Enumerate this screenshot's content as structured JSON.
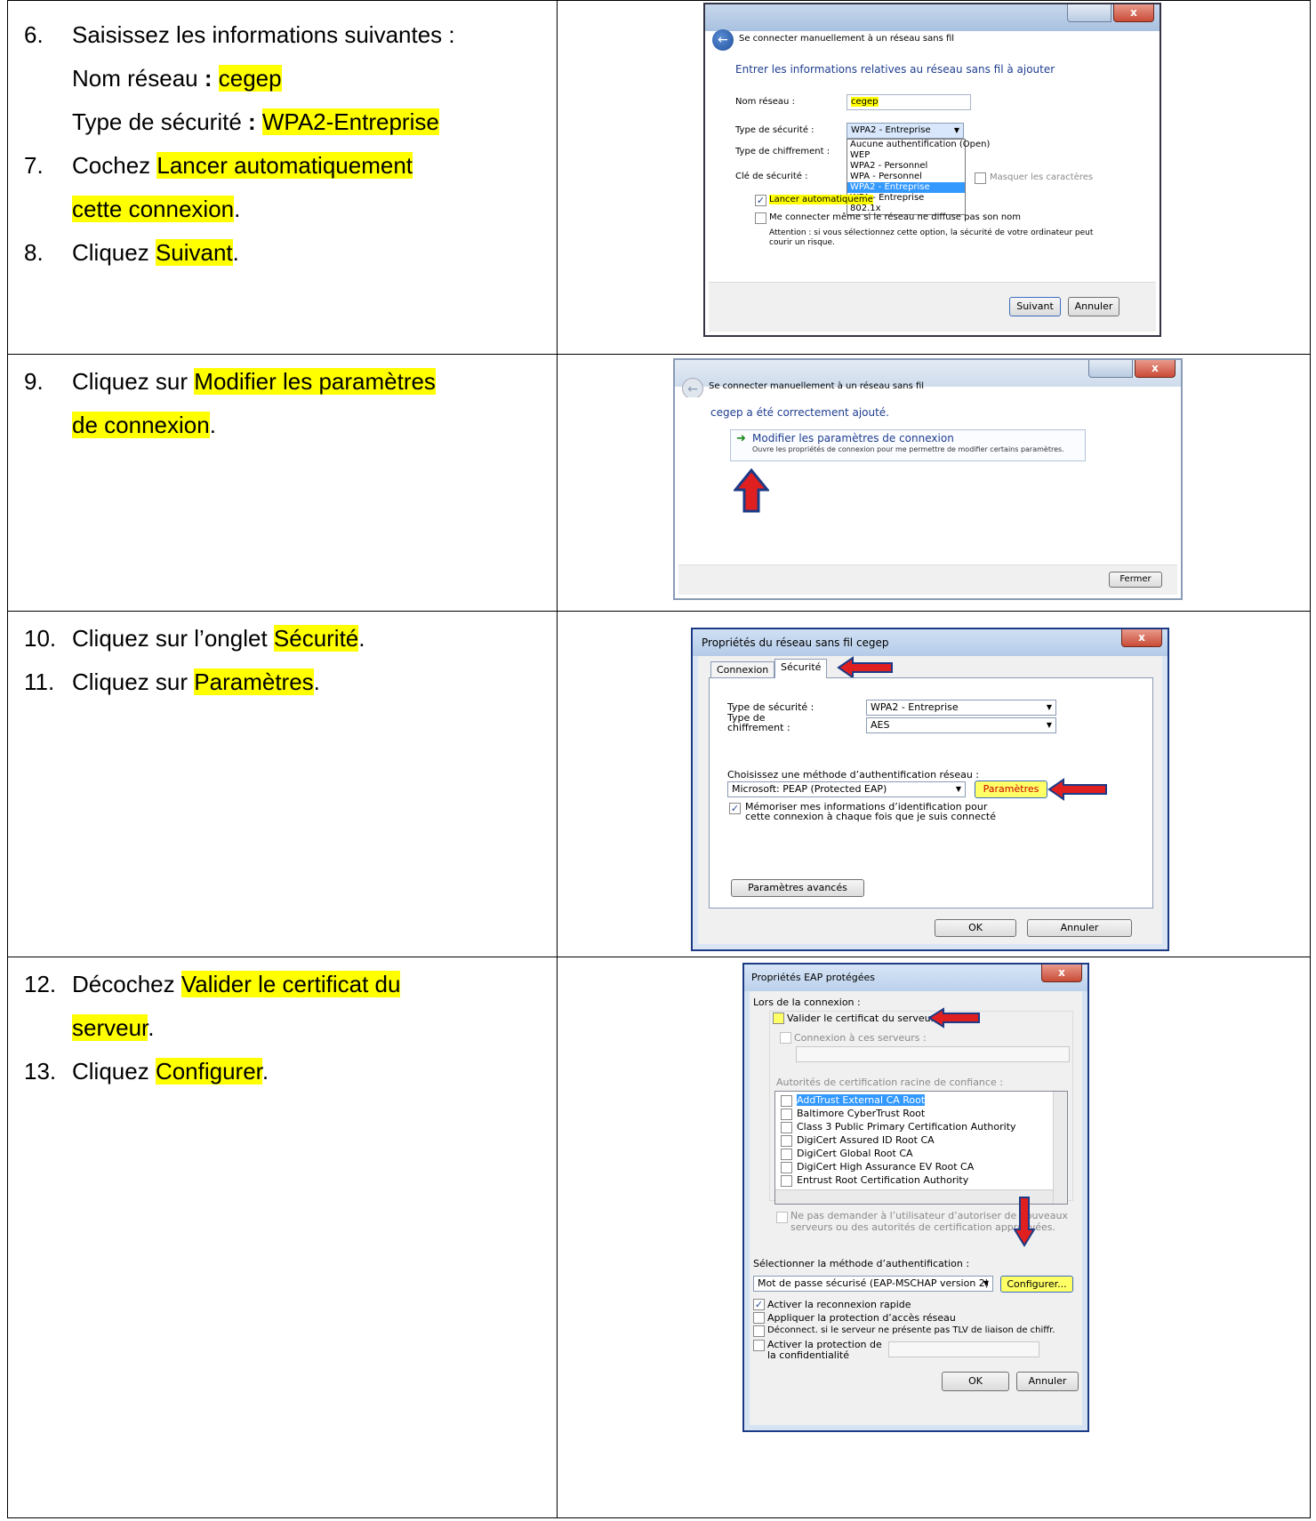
{
  "instructions": {
    "row1": {
      "step6_num": "6.",
      "step6_text": "Saisissez les informations suivantes :",
      "step6_name_label": "Nom réseau",
      "step6_name_sep": " : ",
      "step6_name_value": "cegep",
      "step6_type_label": "Type de sécurité",
      "step6_type_sep": " : ",
      "step6_type_value": "WPA2-Entreprise",
      "step7_num": "7.",
      "step7_prefix": "Cochez ",
      "step7_highlight_line1": "Lancer automatiquement",
      "step7_highlight_line2": "cette connexion",
      "step7_suffix": ".",
      "step8_num": "8.",
      "step8_prefix": "Cliquez ",
      "step8_highlight": "Suivant",
      "step8_suffix": "."
    },
    "row2": {
      "step9_num": "9.",
      "step9_prefix": "Cliquez sur ",
      "step9_highlight_line1": "Modifier les paramètres",
      "step9_highlight_line2": "de connexion",
      "step9_suffix": "."
    },
    "row3": {
      "step10_num": "10.",
      "step10_prefix": "Cliquez sur l’onglet ",
      "step10_highlight": "Sécurité",
      "step10_suffix": ".",
      "step11_num": "11.",
      "step11_prefix": "Cliquez sur ",
      "step11_highlight": "Paramètres",
      "step11_suffix": "."
    },
    "row4": {
      "step12_num": "12.",
      "step12_prefix": "Décochez ",
      "step12_highlight_line1": "Valider le certificat du",
      "step12_highlight_line2": "serveur",
      "step12_suffix": ".",
      "step13_num": "13.",
      "step13_prefix": "Cliquez ",
      "step13_highlight": "Configurer",
      "step13_suffix": "."
    }
  },
  "dialog1": {
    "window_title": "Se connecter manuellement à un réseau sans fil",
    "heading": "Entrer les informations relatives au réseau sans fil à ajouter",
    "label_name": "Nom réseau :",
    "value_name": "cegep",
    "label_security": "Type de sécurité :",
    "value_security": "WPA2 - Entreprise",
    "label_encryption": "Type de chiffrement :",
    "label_key": "Clé de sécurité :",
    "dropdown_options": [
      "Aucune authentification (Open)",
      "WEP",
      "WPA2 - Personnel",
      "WPA - Personnel",
      "WPA2 - Entreprise",
      "WPA - Entreprise",
      "802.1x"
    ],
    "hide_chars": "Masquer les caractères",
    "auto_start": "Lancer automatiqueme",
    "connect_hidden": "Me connecter même si le réseau ne diffuse pas son nom",
    "warning": "Attention : si vous sélectionnez cette option, la sécurité de votre ordinateur peut courir un risque.",
    "next_button": "Suivant",
    "cancel_button": "Annuler"
  },
  "dialog2": {
    "window_title": "Se connecter manuellement à un réseau sans fil",
    "heading": "cegep a été correctement ajouté.",
    "link_title": "Modifier les paramètres de connexion",
    "link_desc": "Ouvre les propriétés de connexion pour me permettre de modifier certains paramètres.",
    "close_button": "Fermer"
  },
  "dialog3": {
    "window_title": "Propriétés du réseau sans fil cegep",
    "tab_connection": "Connexion",
    "tab_security": "Sécurité",
    "label_security": "Type de sécurité :",
    "value_security": "WPA2 - Entreprise",
    "label_encryption_1": "Type de",
    "label_encryption_2": "chiffrement :",
    "value_encryption": "AES",
    "auth_label": "Choisissez une méthode d’authentification réseau :",
    "auth_value": "Microsoft: PEAP (Protected EAP)",
    "settings_button": "Paramètres",
    "remember_1": "Mémoriser mes informations d’identification pour",
    "remember_2": "cette connexion à chaque fois que je suis connecté",
    "advanced_button": "Paramètres avancés",
    "ok_button": "OK",
    "cancel_button": "Annuler"
  },
  "dialog4": {
    "window_title": "Propriétés EAP protégées",
    "on_connect": "Lors de la connexion :",
    "validate_cert": "Valider le certificat du serveur",
    "connect_servers": "Connexion à ces serveurs :",
    "root_ca_label": "Autorités de certification racine de confiance :",
    "ca_list": [
      "AddTrust External CA Root",
      "Baltimore CyberTrust Root",
      "Class 3 Public Primary Certification Authority",
      "DigiCert Assured ID Root CA",
      "DigiCert Global Root CA",
      "DigiCert High Assurance EV Root CA",
      "Entrust Root Certification Authority"
    ],
    "no_prompt_1": "Ne pas demander à l’utilisateur d’autoriser de nouveaux",
    "no_prompt_2": "serveurs ou des autorités de certification approuvées.",
    "auth_method_label": "Sélectionner la méthode d’authentification :",
    "auth_method_value": "Mot de passe sécurisé (EAP-MSCHAP version 2)",
    "configure_button": "Configurer...",
    "fast_reconnect": "Activer la reconnexion rapide",
    "nap": "Appliquer la protection d’accès réseau",
    "disconnect_tlv": "Déconnect. si le serveur ne présente pas TLV de liaison de chiffr.",
    "privacy_1": "Activer la protection de",
    "privacy_2": "la confidentialité",
    "ok_button": "OK",
    "cancel_button": "Annuler"
  }
}
